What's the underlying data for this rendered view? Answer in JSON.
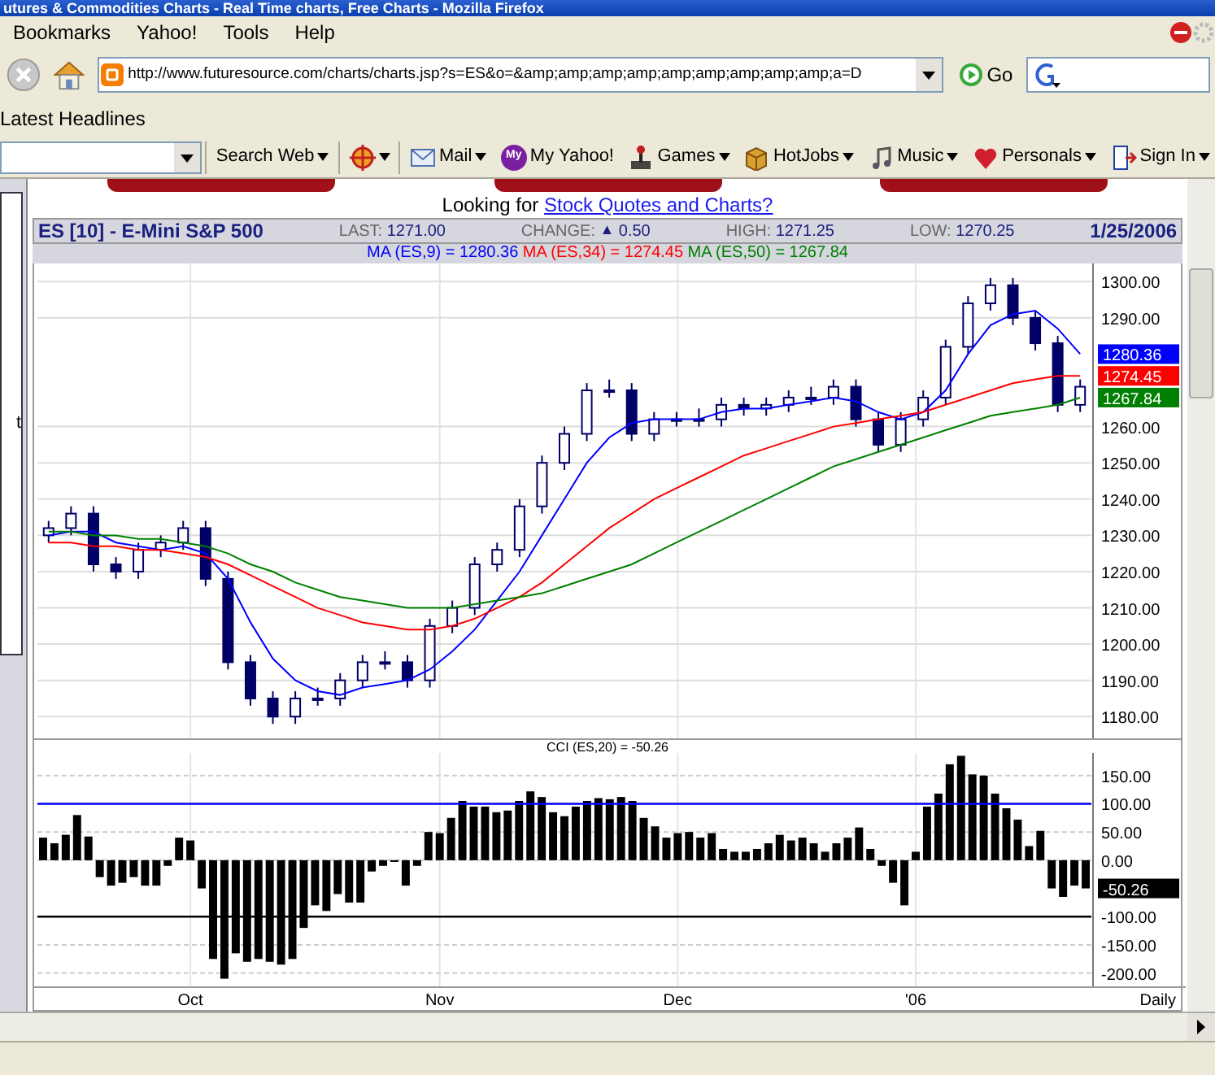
{
  "window": {
    "title": "utures & Commodities Charts - Real Time charts, Free Charts - Mozilla Firefox"
  },
  "menu": [
    "Bookmarks",
    "Yahoo!",
    "Tools",
    "Help"
  ],
  "navigation": {
    "url": "http://www.futuresource.com/charts/charts.jsp?s=ES&o=&amp;amp;amp;amp;amp;amp;amp;amp;amp;a=D",
    "go": "Go"
  },
  "bookmarks_bar": [
    "Latest Headlines"
  ],
  "yahoo_toolbar": [
    {
      "kind": "search",
      "label": "Search Web",
      "dropdown": true
    },
    {
      "kind": "alert",
      "dropdown": true
    },
    {
      "kind": "mail",
      "label": "Mail",
      "dropdown": true
    },
    {
      "kind": "myyahoo",
      "badge": "My",
      "label": "My Yahoo!",
      "dropdown": false
    },
    {
      "kind": "games",
      "label": "Games",
      "dropdown": true
    },
    {
      "kind": "jobs",
      "label": "HotJobs",
      "dropdown": true
    },
    {
      "kind": "music",
      "label": "Music",
      "dropdown": true
    },
    {
      "kind": "personals",
      "label": "Personals",
      "dropdown": true
    },
    {
      "kind": "signin",
      "label": "Sign In",
      "dropdown": true
    }
  ],
  "left_panel_text": "t",
  "page": {
    "prompt": "Looking for ",
    "link": "Stock Quotes and Charts?"
  },
  "quote": {
    "symbol": "ES [10] - E-Mini S&P 500",
    "fields": [
      {
        "label": "LAST:",
        "value": "1271.00"
      },
      {
        "label": "CHANGE:",
        "arrow": "▲",
        "value": "0.50"
      },
      {
        "label": "HIGH:",
        "value": "1271.25"
      },
      {
        "label": "LOW:",
        "value": "1270.25"
      }
    ],
    "date": "1/25/2006",
    "indicator_readings": [
      "= 1280.36",
      "= 1274.45",
      "= 1267.84"
    ]
  },
  "price_chart": {
    "chart_data": {
      "type": "candlestick",
      "grid": true,
      "ylim": [
        1174,
        1305
      ],
      "yticks": [
        {
          "value": 1180,
          "label": "1180.00"
        },
        {
          "value": 1190,
          "label": "1190.00"
        },
        {
          "value": 1200,
          "label": "1200.00"
        },
        {
          "value": 1210,
          "label": "1210.00"
        },
        {
          "value": 1220,
          "label": "1220.00"
        },
        {
          "value": 1230,
          "label": "1230.00"
        },
        {
          "value": 1240,
          "label": "1240.00"
        },
        {
          "value": 1250,
          "label": "1250.00"
        },
        {
          "value": 1260,
          "label": "1260.00"
        },
        {
          "value": 1290,
          "label": "1290.00"
        },
        {
          "value": 1300,
          "label": "1300.00"
        }
      ],
      "categories": [
        null,
        null,
        null,
        null,
        null,
        null,
        null,
        null,
        null,
        null,
        null,
        null,
        null,
        null,
        null,
        null,
        null,
        null,
        null,
        null,
        null,
        null,
        null,
        null,
        null,
        null,
        null,
        null,
        null,
        null,
        null,
        null,
        null,
        null,
        null,
        null,
        null,
        null,
        null,
        null,
        null,
        null,
        null,
        null,
        null,
        null,
        null
      ],
      "ohlc": [
        [
          1230,
          1234,
          1228,
          1232
        ],
        [
          1232,
          1238,
          1230,
          1236
        ],
        [
          1236,
          1238,
          1220,
          1222
        ],
        [
          1222,
          1224,
          1218,
          1220
        ],
        [
          1220,
          1228,
          1218,
          1226
        ],
        [
          1226,
          1230,
          1224,
          1228
        ],
        [
          1228,
          1234,
          1226,
          1232
        ],
        [
          1232,
          1234,
          1216,
          1218
        ],
        [
          1218,
          1220,
          1193,
          1195
        ],
        [
          1195,
          1197,
          1183,
          1185
        ],
        [
          1185,
          1187,
          1178,
          1180
        ],
        [
          1180,
          1187,
          1178,
          1185
        ],
        [
          1185,
          1188,
          1183,
          1185
        ],
        [
          1185,
          1192,
          1183,
          1190
        ],
        [
          1190,
          1197,
          1188,
          1195
        ],
        [
          1195,
          1198,
          1193,
          1195
        ],
        [
          1195,
          1197,
          1188,
          1190
        ],
        [
          1190,
          1207,
          1188,
          1205
        ],
        [
          1205,
          1212,
          1203,
          1210
        ],
        [
          1210,
          1224,
          1208,
          1222
        ],
        [
          1222,
          1228,
          1220,
          1226
        ],
        [
          1226,
          1240,
          1224,
          1238
        ],
        [
          1238,
          1252,
          1236,
          1250
        ],
        [
          1250,
          1260,
          1248,
          1258
        ],
        [
          1258,
          1272,
          1256,
          1270
        ],
        [
          1270,
          1273,
          1268,
          1270
        ],
        [
          1270,
          1272,
          1256,
          1258
        ],
        [
          1258,
          1264,
          1256,
          1262
        ],
        [
          1262,
          1264,
          1260,
          1262
        ],
        [
          1262,
          1265,
          1260,
          1262
        ],
        [
          1262,
          1268,
          1260,
          1266
        ],
        [
          1266,
          1268,
          1263,
          1265
        ],
        [
          1265,
          1268,
          1263,
          1266
        ],
        [
          1266,
          1270,
          1264,
          1268
        ],
        [
          1268,
          1271,
          1266,
          1268
        ],
        [
          1268,
          1273,
          1266,
          1271
        ],
        [
          1271,
          1273,
          1260,
          1262
        ],
        [
          1262,
          1264,
          1253,
          1255
        ],
        [
          1255,
          1264,
          1253,
          1262
        ],
        [
          1262,
          1270,
          1260,
          1268
        ],
        [
          1268,
          1284,
          1266,
          1282
        ],
        [
          1282,
          1296,
          1280,
          1294
        ],
        [
          1294,
          1301,
          1292,
          1299
        ],
        [
          1299,
          1301,
          1288,
          1290
        ],
        [
          1290,
          1292,
          1281,
          1283
        ],
        [
          1283,
          1285,
          1264,
          1266
        ],
        [
          1266,
          1273,
          1264,
          1271
        ]
      ],
      "series": [
        {
          "name": "MA (ES,9)",
          "type": "line",
          "color": "#0000ff",
          "values": [
            1230,
            1231,
            1231,
            1228,
            1227,
            1226,
            1227,
            1225,
            1218,
            1206,
            1196,
            1190,
            1187,
            1186,
            1188,
            1189,
            1190,
            1193,
            1198,
            1204,
            1212,
            1220,
            1230,
            1240,
            1250,
            1257,
            1261,
            1262,
            1262,
            1262,
            1264,
            1265,
            1265,
            1266,
            1267,
            1268,
            1267,
            1264,
            1262,
            1264,
            1270,
            1280,
            1288,
            1291,
            1292,
            1287,
            1280
          ]
        },
        {
          "name": "MA (ES,34)",
          "type": "line",
          "color": "#ff0000",
          "values": [
            1228,
            1228,
            1227,
            1227,
            1226,
            1226,
            1225,
            1224,
            1222,
            1219,
            1216,
            1213,
            1210,
            1208,
            1206,
            1205,
            1204,
            1204,
            1205,
            1207,
            1210,
            1213,
            1217,
            1222,
            1227,
            1232,
            1236,
            1240,
            1243,
            1246,
            1249,
            1252,
            1254,
            1256,
            1258,
            1260,
            1261,
            1262,
            1263,
            1264,
            1266,
            1268,
            1270,
            1272,
            1273,
            1274,
            1274
          ]
        },
        {
          "name": "MA (ES,50)",
          "type": "line",
          "color": "#008000",
          "values": [
            1231,
            1231,
            1230,
            1230,
            1229,
            1229,
            1228,
            1227,
            1225,
            1222,
            1220,
            1217,
            1215,
            1213,
            1212,
            1211,
            1210,
            1210,
            1210,
            1211,
            1212,
            1213,
            1214,
            1216,
            1218,
            1220,
            1222,
            1225,
            1228,
            1231,
            1234,
            1237,
            1240,
            1243,
            1246,
            1249,
            1251,
            1253,
            1255,
            1257,
            1259,
            1261,
            1263,
            1264,
            1265,
            1266,
            1268
          ]
        }
      ],
      "annotations": [
        "1280.36",
        "1274.45",
        "1267.84"
      ]
    }
  },
  "cci_chart": {
    "title_reading": "= -50.26",
    "chart_data": {
      "type": "bar",
      "grid": true,
      "xlabel": "Daily",
      "ylim": [
        -225,
        190
      ],
      "yticks": [
        {
          "value": -200,
          "label": "-200.00"
        },
        {
          "value": -150,
          "label": "-150.00"
        },
        {
          "value": -100,
          "label": "-100.00"
        },
        {
          "value": 0,
          "label": "0.00"
        },
        {
          "value": 50,
          "label": "50.00"
        },
        {
          "value": 100,
          "label": "100.00"
        },
        {
          "value": 150,
          "label": "150.00"
        }
      ],
      "categories": [
        null,
        null,
        null,
        null,
        null,
        null,
        null,
        null,
        null,
        null,
        null,
        null,
        null,
        "Oct",
        null,
        null,
        null,
        null,
        null,
        null,
        null,
        null,
        null,
        null,
        null,
        null,
        null,
        null,
        null,
        null,
        null,
        null,
        null,
        null,
        null,
        "Nov",
        null,
        null,
        null,
        null,
        null,
        null,
        null,
        null,
        null,
        null,
        null,
        null,
        null,
        null,
        null,
        null,
        null,
        null,
        null,
        null,
        "Dec",
        null,
        null,
        null,
        null,
        null,
        null,
        null,
        null,
        null,
        null,
        null,
        null,
        null,
        null,
        null,
        null,
        null,
        null,
        null,
        null,
        "'06",
        null,
        null,
        null,
        null,
        null,
        null,
        null,
        null,
        null,
        null,
        null,
        null,
        null,
        null,
        null
      ],
      "series": [
        {
          "name": "CCI (ES,20)",
          "color": "#000000",
          "values": [
            40,
            30,
            45,
            80,
            42,
            -30,
            -45,
            -40,
            -30,
            -45,
            -45,
            -10,
            40,
            35,
            -50,
            -175,
            -210,
            -165,
            -180,
            -175,
            -180,
            -185,
            -175,
            -120,
            -80,
            -90,
            -60,
            -75,
            -75,
            -20,
            -10,
            -3,
            -45,
            -10,
            50,
            48,
            75,
            105,
            95,
            95,
            85,
            88,
            105,
            122,
            112,
            85,
            78,
            95,
            105,
            110,
            108,
            112,
            105,
            75,
            60,
            40,
            48,
            50,
            40,
            48,
            20,
            15,
            15,
            20,
            30,
            45,
            35,
            40,
            30,
            15,
            30,
            40,
            58,
            20,
            -10,
            -40,
            -80,
            15,
            95,
            118,
            170,
            185,
            152,
            150,
            118,
            92,
            72,
            25,
            52,
            -50,
            -65,
            -45,
            -50
          ]
        }
      ],
      "ref_lines": [
        {
          "axis": "y",
          "value": 100,
          "color": "#0000ff"
        },
        {
          "axis": "y",
          "value": -100,
          "color": "#000000"
        }
      ],
      "annotations": [
        "-50.26"
      ]
    }
  }
}
